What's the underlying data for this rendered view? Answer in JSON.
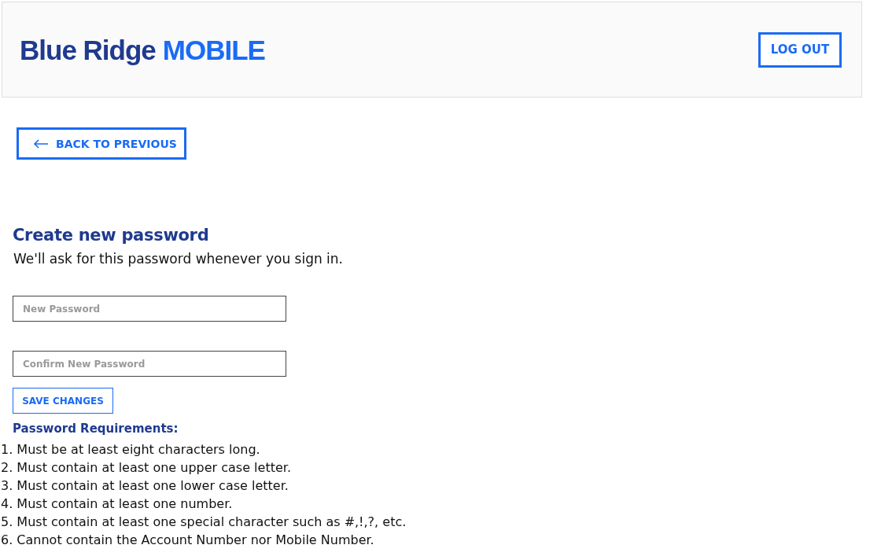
{
  "header": {
    "logo": {
      "primary": "Blue Ridge",
      "accent": "MOBILE"
    },
    "logout_button": "LOG OUT"
  },
  "back_button": {
    "label": "BACK TO PREVIOUS"
  },
  "form": {
    "title": "Create new password",
    "subtitle": "We'll ask for this password whenever you sign in.",
    "fields": [
      {
        "placeholder": "New Password"
      },
      {
        "placeholder": "Confirm New Password"
      }
    ],
    "save_button": "SAVE CHANGES"
  },
  "requirements": {
    "title": "Password Requirements:",
    "items": [
      {
        "number": "1.",
        "text": "Must be at least eight characters long."
      },
      {
        "number": "2.",
        "text": "Must contain at least one upper case letter."
      },
      {
        "number": "3.",
        "text": "Must contain at least one lower case letter."
      },
      {
        "number": "4.",
        "text": "Must contain at least one number."
      },
      {
        "number": "5.",
        "text": "Must contain at least one special character such as #,!,?, etc."
      },
      {
        "number": "6.",
        "text": "Cannot contain the Account Number nor Mobile Number."
      }
    ]
  }
}
